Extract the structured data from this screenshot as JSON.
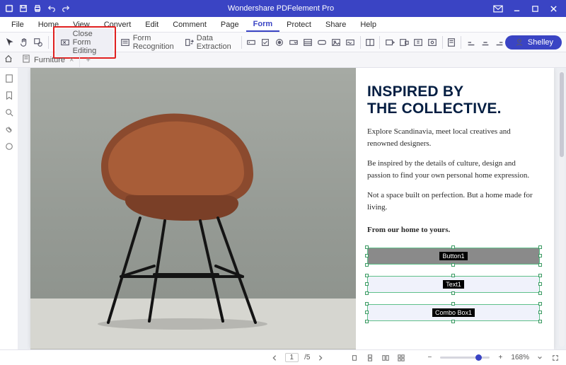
{
  "titlebar": {
    "app_name": "Wondershare PDFelement Pro"
  },
  "menu": {
    "items": [
      "File",
      "Home",
      "View",
      "Convert",
      "Edit",
      "Comment",
      "Page",
      "Form",
      "Protect",
      "Share",
      "Help"
    ],
    "active_index": 7
  },
  "ribbon": {
    "close_form_editing": "Close Form Editing",
    "form_recognition": "Form Recognition",
    "data_extraction": "Data Extraction",
    "user_name": "Shelley"
  },
  "tabs": {
    "open_doc": "Furniture"
  },
  "document": {
    "heading_line1": "INSPIRED BY",
    "heading_line2": "THE COLLECTIVE.",
    "p1": "Explore Scandinavia, meet local creatives and renowned designers.",
    "p2": "Be inspired by the details of culture, design and passion to find your own personal home expression.",
    "p3": "Not a space built on perfection. But a home made for living.",
    "p4": "From our home to yours.",
    "field_button": "Button1",
    "field_text": "Text1",
    "field_combo": "Combo Box1"
  },
  "status": {
    "page": "1",
    "page_sep": "/5",
    "zoom": "168%"
  }
}
